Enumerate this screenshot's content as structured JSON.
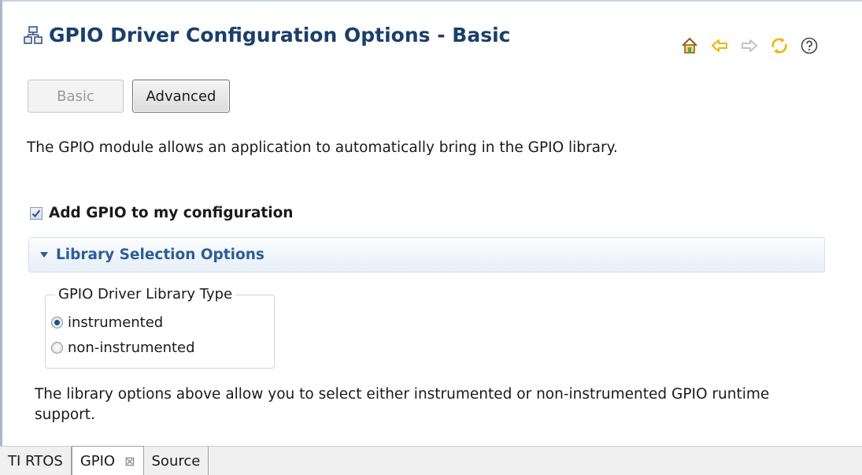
{
  "page": {
    "title": "GPIO Driver Configuration Options - Basic"
  },
  "toolbar": {
    "icons": [
      "home-icon",
      "back-icon",
      "forward-icon",
      "sync-icon",
      "help-icon"
    ]
  },
  "mode_buttons": {
    "basic_label": "Basic",
    "advanced_label": "Advanced"
  },
  "description": "The GPIO module allows an application to automatically bring in the GPIO library.",
  "add_checkbox": {
    "label": "Add GPIO to my configuration",
    "checked": true
  },
  "section": {
    "title": "Library Selection Options"
  },
  "library_group": {
    "legend": "GPIO Driver Library Type",
    "options": [
      {
        "label": "instrumented",
        "selected": true
      },
      {
        "label": "non-instrumented",
        "selected": false
      }
    ]
  },
  "note": "The library options above allow you to select either instrumented or non-instrumented GPIO runtime support.",
  "tabs": [
    {
      "label": "TI RTOS"
    },
    {
      "label": "GPIO",
      "close": "⊠"
    },
    {
      "label": "Source"
    }
  ],
  "colors": {
    "title": "#1b3f6b",
    "section_title": "#2c5d97",
    "icon_yellow": "#f0b400"
  }
}
